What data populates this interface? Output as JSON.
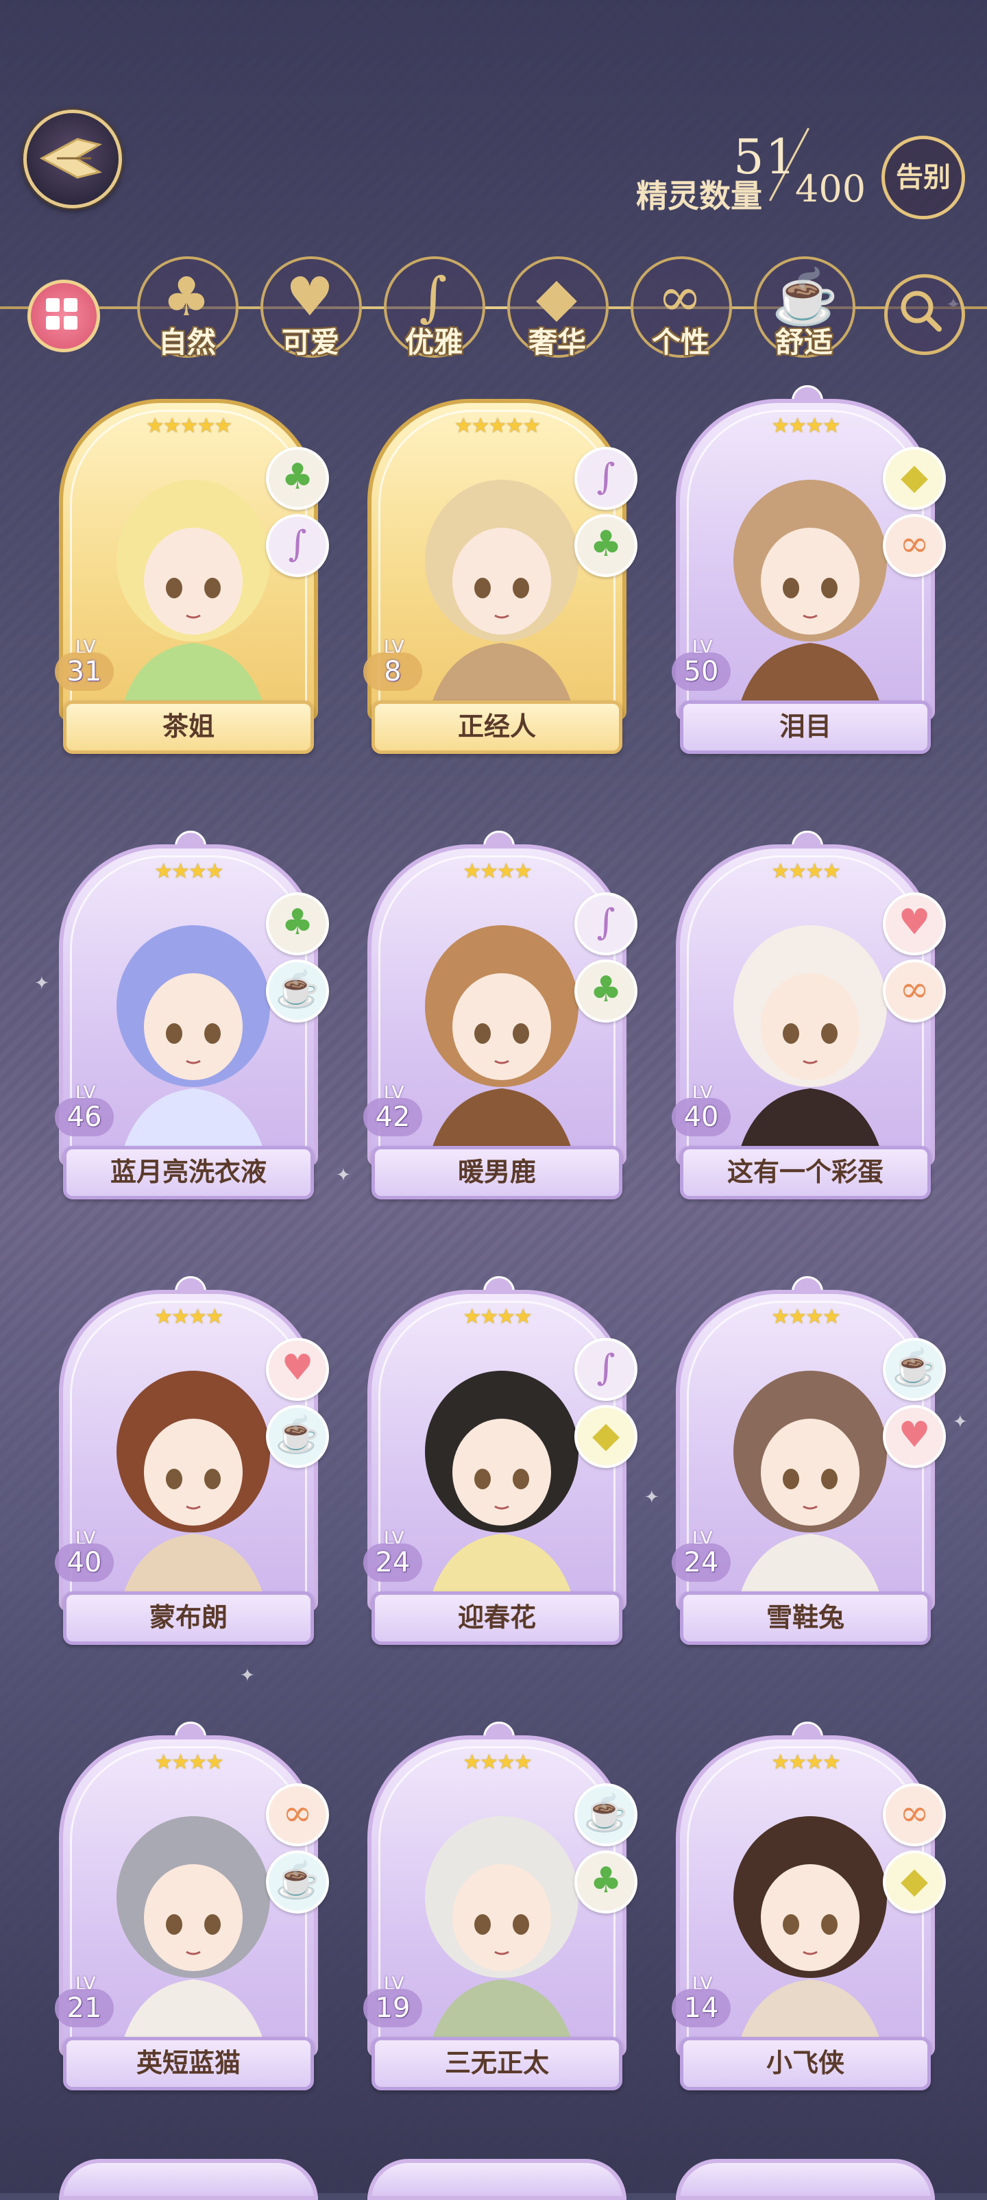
{
  "header": {
    "count_label": "精灵数量",
    "count_current": "51",
    "count_max": "400",
    "farewell_label": "告别"
  },
  "filters": [
    {
      "label": "自然",
      "icon": "clover-icon",
      "glyph": "♣"
    },
    {
      "label": "可爱",
      "icon": "heart-icon",
      "glyph": "♥"
    },
    {
      "label": "优雅",
      "icon": "swan-icon",
      "glyph": "∫"
    },
    {
      "label": "奢华",
      "icon": "diamond-icon",
      "glyph": "◆"
    },
    {
      "label": "个性",
      "icon": "glasses-icon",
      "glyph": "∞"
    },
    {
      "label": "舒适",
      "icon": "teacup-icon",
      "glyph": "☕"
    }
  ],
  "spirits": [
    {
      "name": "茶姐",
      "level": "31",
      "stars": "★★★★★",
      "attrs": [
        "nature",
        "elegant"
      ]
    },
    {
      "name": "正经人",
      "level": "8",
      "stars": "★★★★★",
      "attrs": [
        "elegant",
        "nature"
      ]
    },
    {
      "name": "泪目",
      "level": "50",
      "stars": "★★★★",
      "attrs": [
        "luxury",
        "personality"
      ]
    },
    {
      "name": "蓝月亮洗衣液",
      "level": "46",
      "stars": "★★★★",
      "attrs": [
        "nature",
        "comfort"
      ]
    },
    {
      "name": "暖男鹿",
      "level": "42",
      "stars": "★★★★",
      "attrs": [
        "elegant",
        "nature"
      ]
    },
    {
      "name": "这有一个彩蛋",
      "level": "40",
      "stars": "★★★★",
      "attrs": [
        "cute",
        "personality"
      ]
    },
    {
      "name": "蒙布朗",
      "level": "40",
      "stars": "★★★★",
      "attrs": [
        "cute",
        "comfort"
      ]
    },
    {
      "name": "迎春花",
      "level": "24",
      "stars": "★★★★",
      "attrs": [
        "elegant",
        "luxury"
      ]
    },
    {
      "name": "雪鞋兔",
      "level": "24",
      "stars": "★★★★",
      "attrs": [
        "comfort",
        "cute"
      ]
    },
    {
      "name": "英短蓝猫",
      "level": "21",
      "stars": "★★★★",
      "attrs": [
        "personality",
        "comfort"
      ]
    },
    {
      "name": "三无正太",
      "level": "19",
      "stars": "★★★★",
      "attrs": [
        "comfort",
        "nature"
      ]
    },
    {
      "name": "小飞侠",
      "level": "14",
      "stars": "★★★★",
      "attrs": [
        "personality",
        "luxury"
      ]
    }
  ],
  "lv_label": "LV",
  "attr_glyphs": {
    "nature": "♣",
    "cute": "♥",
    "elegant": "∫",
    "luxury": "◆",
    "personality": "∞",
    "comfort": "☕"
  }
}
